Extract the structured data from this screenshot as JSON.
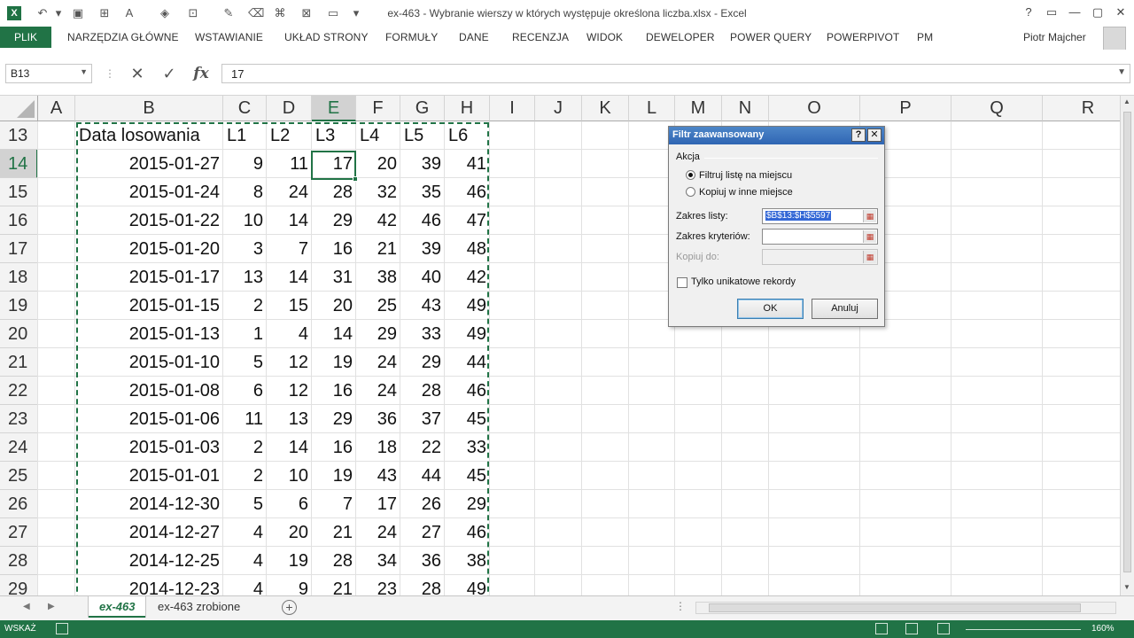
{
  "app": {
    "title": "ex-463 - Wybranie wierszy w których występuje określona liczba.xlsx - Excel",
    "logo": "X",
    "user": "Piotr Majcher",
    "window_controls": [
      "?",
      "▭",
      "—",
      "▢",
      "✕"
    ]
  },
  "quick_access": [
    "undo-icon",
    "redo-icon",
    "save-icon",
    "font-size-icon",
    "font-color-icon",
    "fill-color-icon",
    "border-icon",
    "format-painter-icon",
    "eraser-icon",
    "hierarchy-icon",
    "print-area-icon",
    "view-icon"
  ],
  "ribbon": {
    "file": "PLIK",
    "tabs": [
      "NARZĘDZIA GŁÓWNE",
      "WSTAWIANIE",
      "UKŁAD STRONY",
      "FORMUŁY",
      "DANE",
      "RECENZJA",
      "WIDOK",
      "DEWELOPER",
      "POWER QUERY",
      "POWERPIVOT",
      "PM"
    ]
  },
  "formula_bar": {
    "name_box": "B13",
    "formula": "17",
    "fx": "fx"
  },
  "columns": [
    "A",
    "B",
    "C",
    "D",
    "E",
    "F",
    "G",
    "H",
    "I",
    "J",
    "K",
    "L",
    "M",
    "N",
    "O",
    "P",
    "Q",
    "R"
  ],
  "selected_column": "E",
  "rows": [
    {
      "num": "13",
      "date": "Data losowania",
      "vals": [
        "L1",
        "L2",
        "L3",
        "L4",
        "L5",
        "L6"
      ]
    },
    {
      "num": "14",
      "date": "2015-01-27",
      "vals": [
        "9",
        "11",
        "17",
        "20",
        "39",
        "41"
      ]
    },
    {
      "num": "15",
      "date": "2015-01-24",
      "vals": [
        "8",
        "24",
        "28",
        "32",
        "35",
        "46"
      ]
    },
    {
      "num": "16",
      "date": "2015-01-22",
      "vals": [
        "10",
        "14",
        "29",
        "42",
        "46",
        "47"
      ]
    },
    {
      "num": "17",
      "date": "2015-01-20",
      "vals": [
        "3",
        "7",
        "16",
        "21",
        "39",
        "48"
      ]
    },
    {
      "num": "18",
      "date": "2015-01-17",
      "vals": [
        "13",
        "14",
        "31",
        "38",
        "40",
        "42"
      ]
    },
    {
      "num": "19",
      "date": "2015-01-15",
      "vals": [
        "2",
        "15",
        "20",
        "25",
        "43",
        "49"
      ]
    },
    {
      "num": "20",
      "date": "2015-01-13",
      "vals": [
        "1",
        "4",
        "14",
        "29",
        "33",
        "49"
      ]
    },
    {
      "num": "21",
      "date": "2015-01-10",
      "vals": [
        "5",
        "12",
        "19",
        "24",
        "29",
        "44"
      ]
    },
    {
      "num": "22",
      "date": "2015-01-08",
      "vals": [
        "6",
        "12",
        "16",
        "24",
        "28",
        "46"
      ]
    },
    {
      "num": "23",
      "date": "2015-01-06",
      "vals": [
        "11",
        "13",
        "29",
        "36",
        "37",
        "45"
      ]
    },
    {
      "num": "24",
      "date": "2015-01-03",
      "vals": [
        "2",
        "14",
        "16",
        "18",
        "22",
        "33"
      ]
    },
    {
      "num": "25",
      "date": "2015-01-01",
      "vals": [
        "2",
        "10",
        "19",
        "43",
        "44",
        "45"
      ]
    },
    {
      "num": "26",
      "date": "2014-12-30",
      "vals": [
        "5",
        "6",
        "7",
        "17",
        "26",
        "29"
      ]
    },
    {
      "num": "27",
      "date": "2014-12-27",
      "vals": [
        "4",
        "20",
        "21",
        "24",
        "27",
        "46"
      ]
    },
    {
      "num": "28",
      "date": "2014-12-25",
      "vals": [
        "4",
        "19",
        "28",
        "34",
        "36",
        "38"
      ]
    },
    {
      "num": "29",
      "date": "2014-12-23",
      "vals": [
        "4",
        "9",
        "21",
        "23",
        "28",
        "49"
      ]
    }
  ],
  "selected_row": "14",
  "dialog": {
    "title": "Filtr zaawansowany",
    "help": "?",
    "close": "✕",
    "group_label": "Akcja",
    "option_filter_in_place": "Filtruj listę na miejscu",
    "option_copy_elsewhere": "Kopiuj w inne miejsce",
    "list_range_label": "Zakres listy:",
    "list_range_value": "$B$13:$H$5597",
    "criteria_range_label": "Zakres kryteriów:",
    "criteria_range_value": "",
    "copy_to_label": "Kopiuj do:",
    "copy_to_value": "",
    "unique_label": "Tylko unikatowe rekordy",
    "ok": "OK",
    "cancel": "Anuluj"
  },
  "sheets": {
    "tabs": [
      "ex-463",
      "ex-463 zrobione"
    ],
    "active": "ex-463",
    "add": "+"
  },
  "status": {
    "mode": "WSKAŻ",
    "zoom": "160%"
  },
  "colors": {
    "accent": "#217346",
    "dialog_title": "#2f65b3"
  }
}
